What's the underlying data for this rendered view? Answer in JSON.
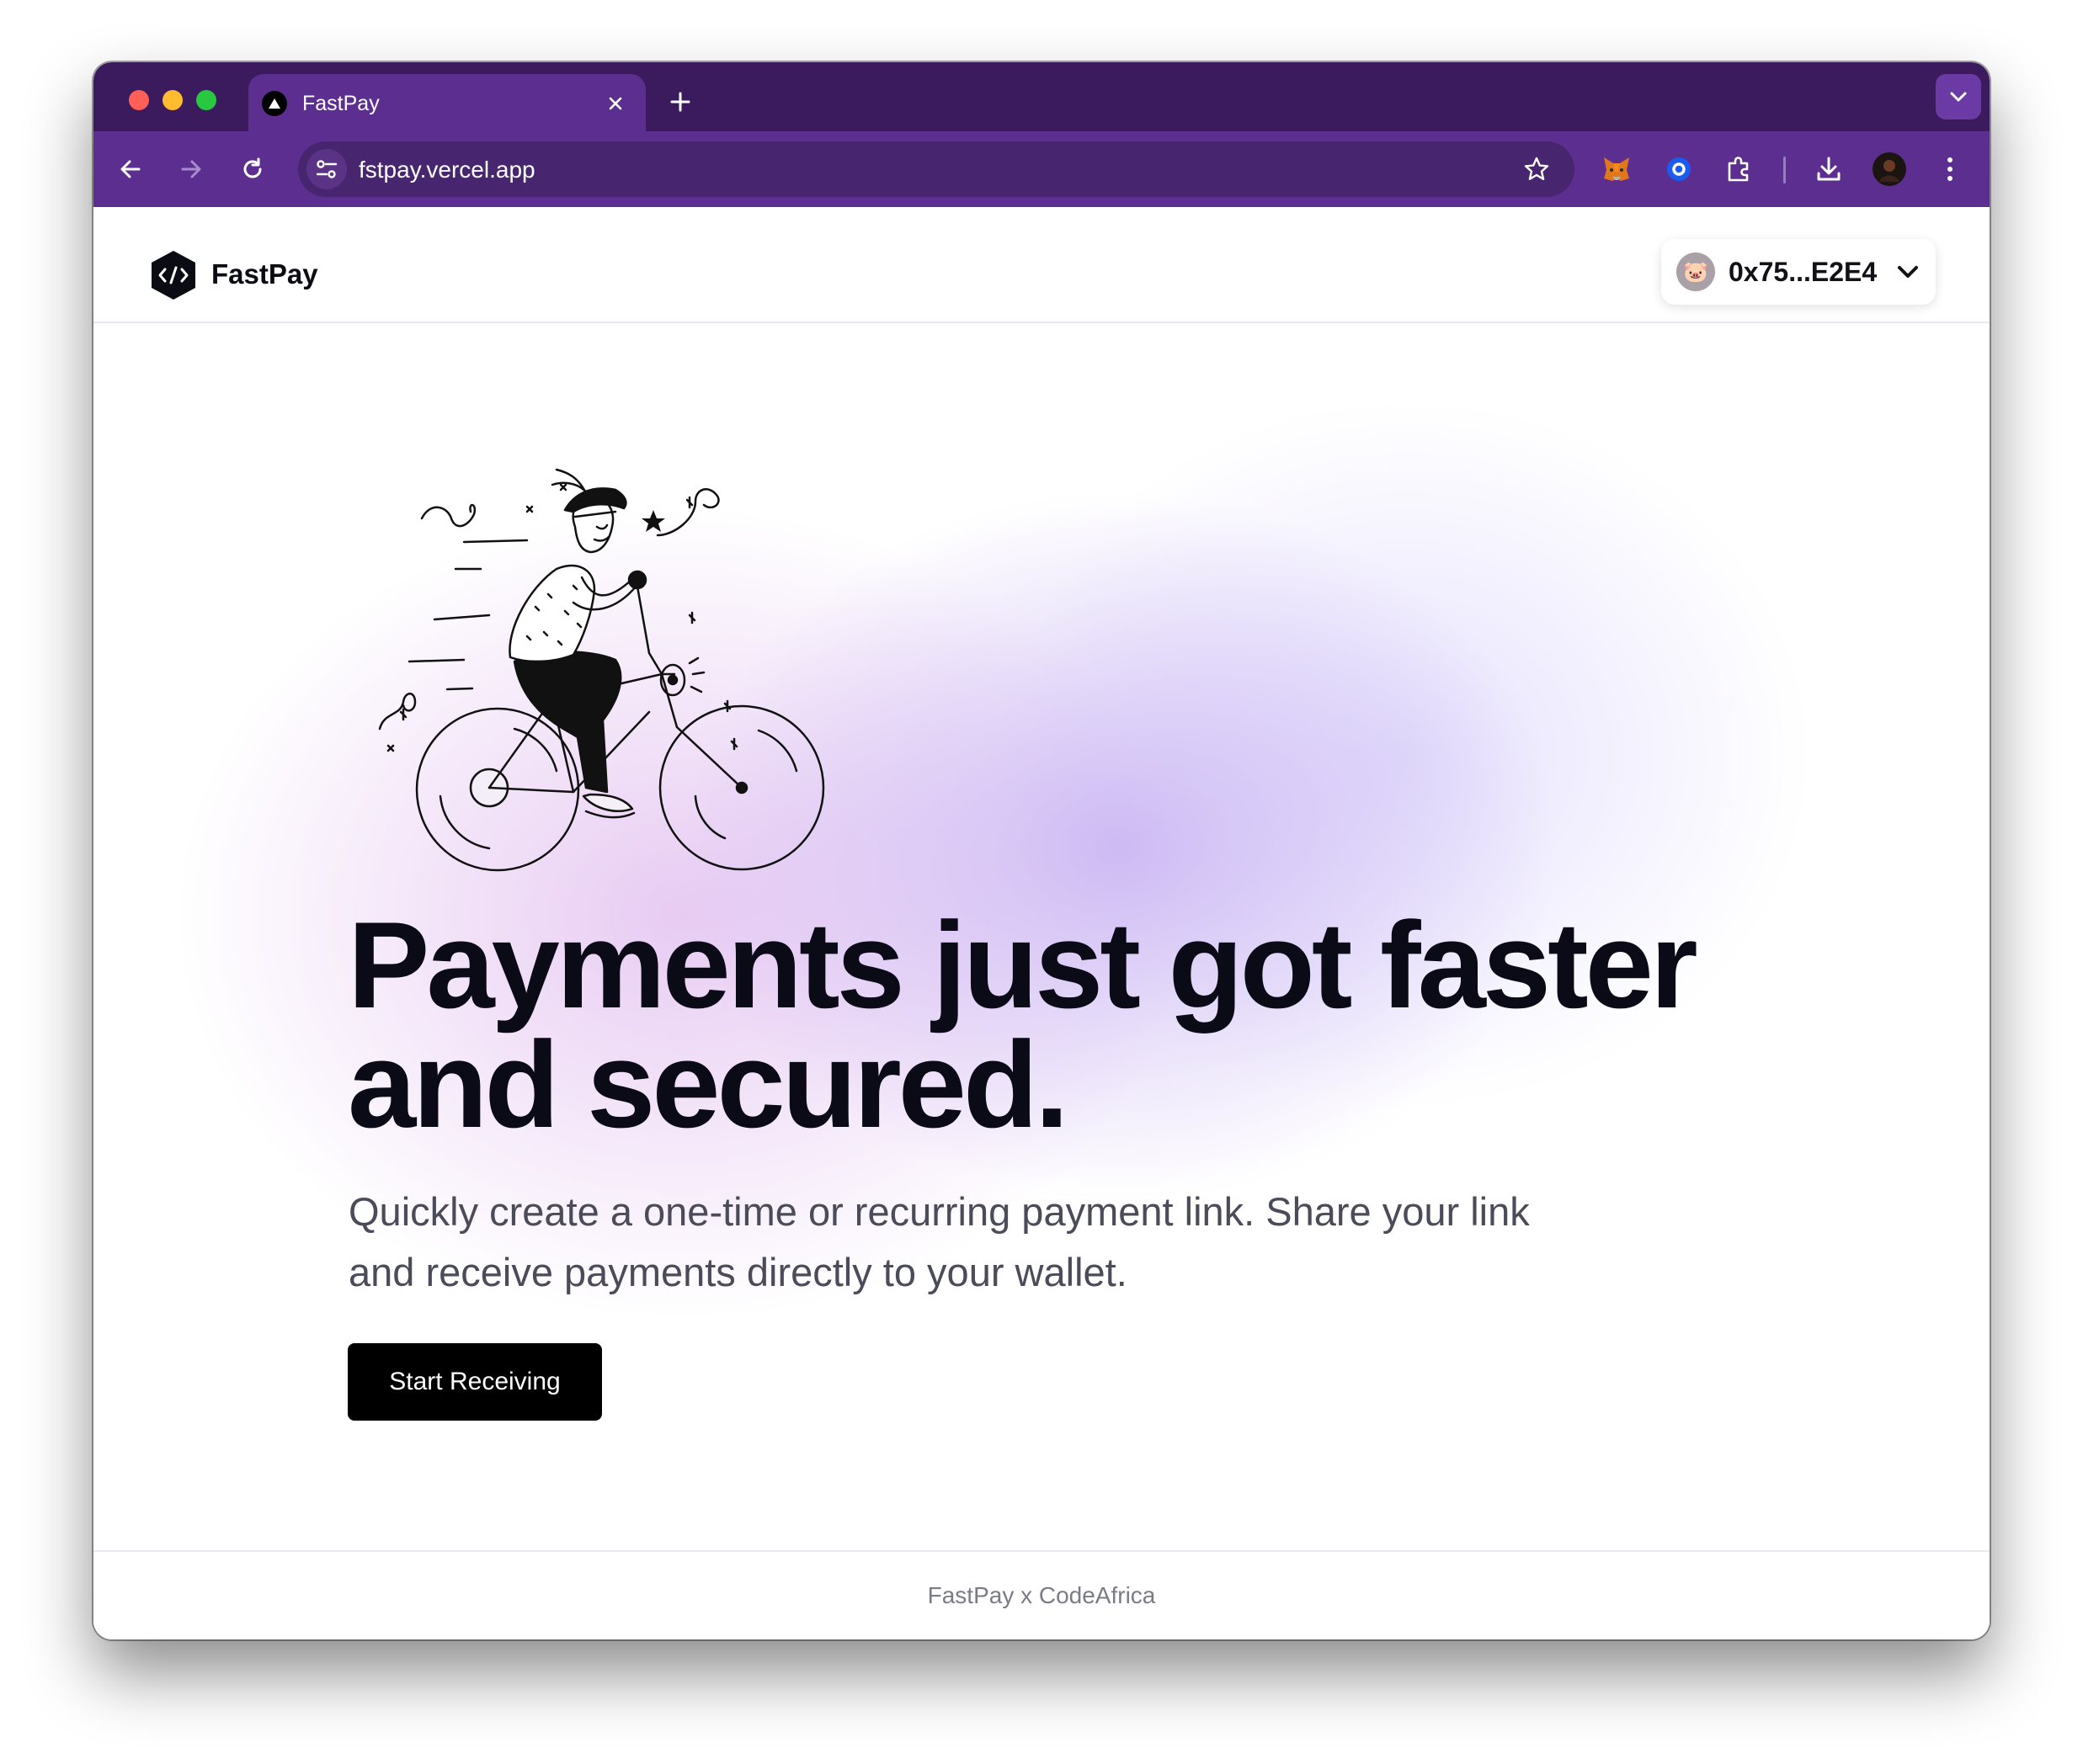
{
  "browser": {
    "tab": {
      "title": "FastPay"
    },
    "url": "fstpay.vercel.app",
    "theme_color": "#5b2e8f"
  },
  "app": {
    "brand": "FastPay",
    "wallet": {
      "address": "0x75...E2E4",
      "avatar": "🐷"
    },
    "hero": {
      "headline": "Payments just got faster and secured.",
      "subtext": "Quickly create a one-time or recurring payment link. Share your link and receive payments directly to your wallet.",
      "cta_label": "Start Receiving"
    },
    "footer": {
      "text": "FastPay x CodeAfrica"
    }
  }
}
